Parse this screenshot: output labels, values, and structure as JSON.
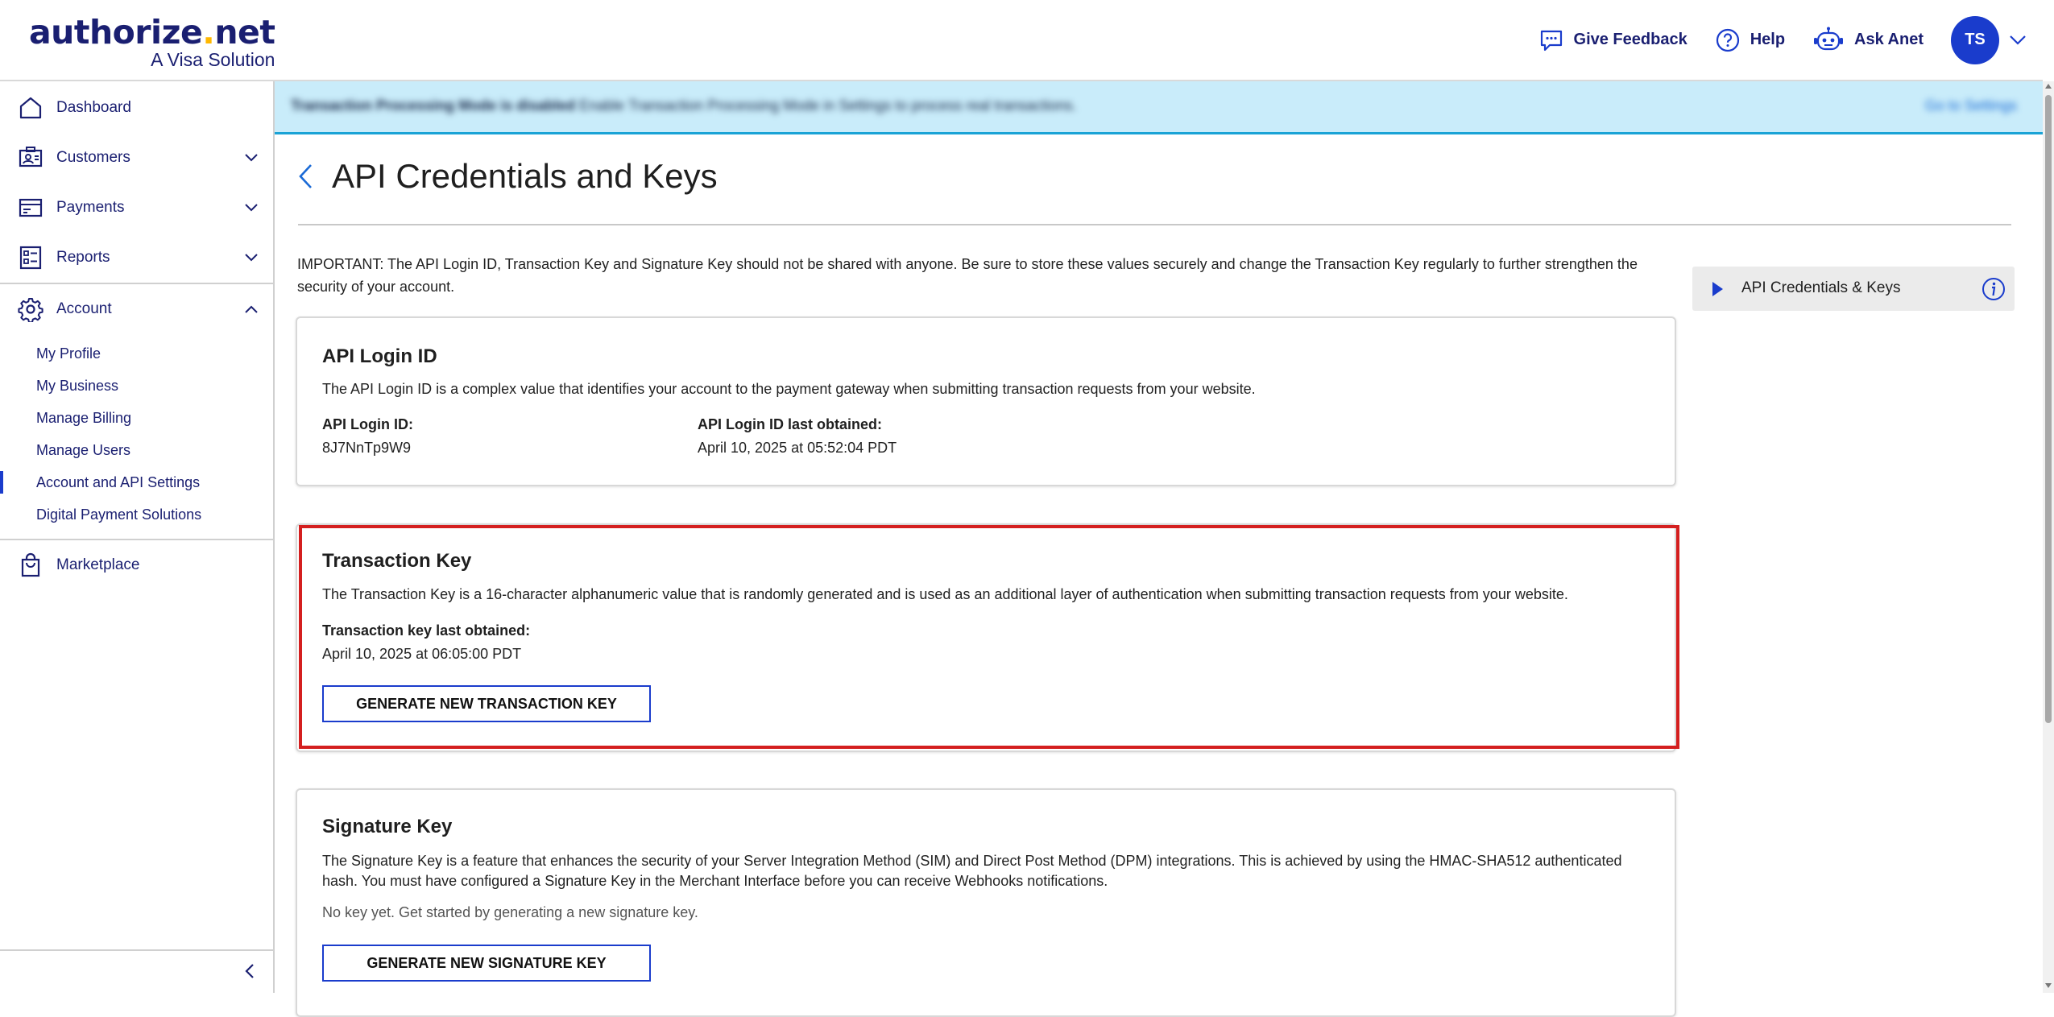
{
  "brand": {
    "name_part1": "authorize",
    "name_dot": ".",
    "name_part2": "net",
    "tagline": "A Visa Solution"
  },
  "header": {
    "feedback_label": "Give Feedback",
    "help_label": "Help",
    "ask_label": "Ask Anet",
    "avatar_initials": "TS"
  },
  "sidebar": {
    "items": [
      {
        "label": "Dashboard"
      },
      {
        "label": "Customers"
      },
      {
        "label": "Payments"
      },
      {
        "label": "Reports"
      },
      {
        "label": "Account"
      }
    ],
    "account_sub": [
      {
        "label": "My Profile"
      },
      {
        "label": "My Business"
      },
      {
        "label": "Manage Billing"
      },
      {
        "label": "Manage Users"
      },
      {
        "label": "Account and API Settings"
      },
      {
        "label": "Digital Payment Solutions"
      }
    ],
    "marketplace_label": "Marketplace"
  },
  "banner": {
    "bold_text": "Transaction Processing Mode is disabled",
    "text": " Enable Transaction Processing Mode in Settings to process real transactions.",
    "link_label": "Go to Settings"
  },
  "page": {
    "title": "API Credentials and Keys",
    "notice": "IMPORTANT: The API Login ID, Transaction Key and Signature Key should not be shared with anyone. Be sure to store these values securely and change the Transaction Key regularly to further strengthen the security of your account."
  },
  "login_card": {
    "title": "API Login ID",
    "description": "The API Login ID is a complex value that identifies your account to the payment gateway when submitting transaction requests from your website.",
    "id_label": "API Login ID:",
    "id_value": "8J7NnTp9W9",
    "obtained_label": "API Login ID last obtained:",
    "obtained_value": "April 10, 2025 at 05:52:04 PDT"
  },
  "transaction_card": {
    "title": "Transaction Key",
    "description": "The Transaction Key is a 16-character alphanumeric value that is randomly generated and is used as an additional layer of authentication when submitting transaction requests from your website.",
    "obtained_label": "Transaction key last obtained:",
    "obtained_value": "April 10, 2025 at 06:05:00 PDT",
    "button_label": "GENERATE NEW TRANSACTION KEY"
  },
  "signature_card": {
    "title": "Signature Key",
    "description": "The Signature Key is a feature that enhances the security of your Server Integration Method (SIM) and Direct Post Method (DPM) integrations. This is achieved by using the HMAC-SHA512 authenticated hash. You must have configured a Signature Key in the Merchant Interface before you can receive Webhooks notifications.",
    "note": "No key yet. Get started by generating a new signature key.",
    "button_label": "GENERATE NEW SIGNATURE KEY"
  },
  "side_panel": {
    "label": "API Credentials & Keys"
  },
  "colors": {
    "brand_navy": "#1a1f71",
    "accent_blue": "#1a3ccc",
    "banner_bg": "#c9ecfa",
    "highlight_red": "#d41f1f",
    "logo_dot": "#ffb700"
  },
  "icons": [
    "home-icon",
    "customers-icon",
    "payments-icon",
    "reports-icon",
    "gear-icon",
    "shopping-bag-icon",
    "chat-bubble-icon",
    "help-circle-icon",
    "robot-icon",
    "info-icon",
    "chevron-left-icon",
    "chevron-down-icon",
    "chevron-up-icon",
    "play-triangle-icon"
  ]
}
